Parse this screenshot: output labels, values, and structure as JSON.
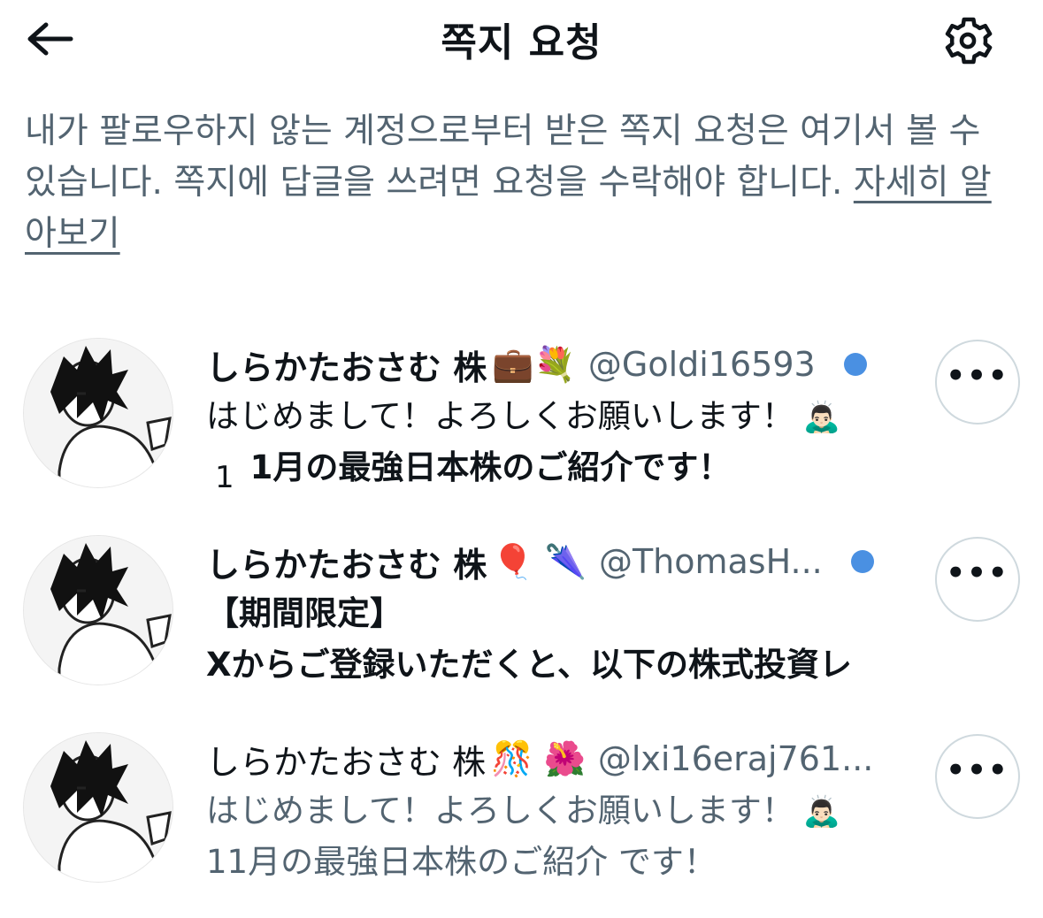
{
  "header": {
    "title": "쪽지 요청",
    "back_icon": "arrow-left-icon",
    "settings_icon": "gear-icon"
  },
  "intro": {
    "text": "내가 팔로우하지 않는 계정으로부터 받은 쪽지 요청은 여기서 볼 수 있습니다. 쪽지에 답글을 쓰려면 요청을 수락해야 합니다. ",
    "link": "자세히 알아보기"
  },
  "requests": [
    {
      "name": "しらかたおさむ 株",
      "emojis": "💼💐",
      "handle": "@Goldi16593",
      "unread": true,
      "line1": "はじめまして！よろしくお願いします！",
      "line1_emoji": "🙇🏻‍♂️",
      "line2_prefix": "1",
      "line2": "1月の最強日本株のご紹介です！"
    },
    {
      "name": "しらかたおさむ 株",
      "emojis": "🎈 🌂",
      "handle": "@ThomasH...",
      "unread": true,
      "line1": "【期間限定】",
      "line2": "Xからご登録いただくと、以下の株式投資レ"
    },
    {
      "name": "しらかたおさむ 株",
      "emojis": "🎊 🌺",
      "handle": "@lxi16eraj761...",
      "unread": false,
      "line1": "はじめまして！よろしくお願いします！",
      "line1_emoji": "🙇🏻‍♂️",
      "line2": "11月の最強日本株のご紹介 です！"
    }
  ],
  "more_label": "•••",
  "colors": {
    "text": "#0f1419",
    "secondary": "#536471",
    "unread_dot": "#4a90e2",
    "border": "#cfd9de"
  }
}
